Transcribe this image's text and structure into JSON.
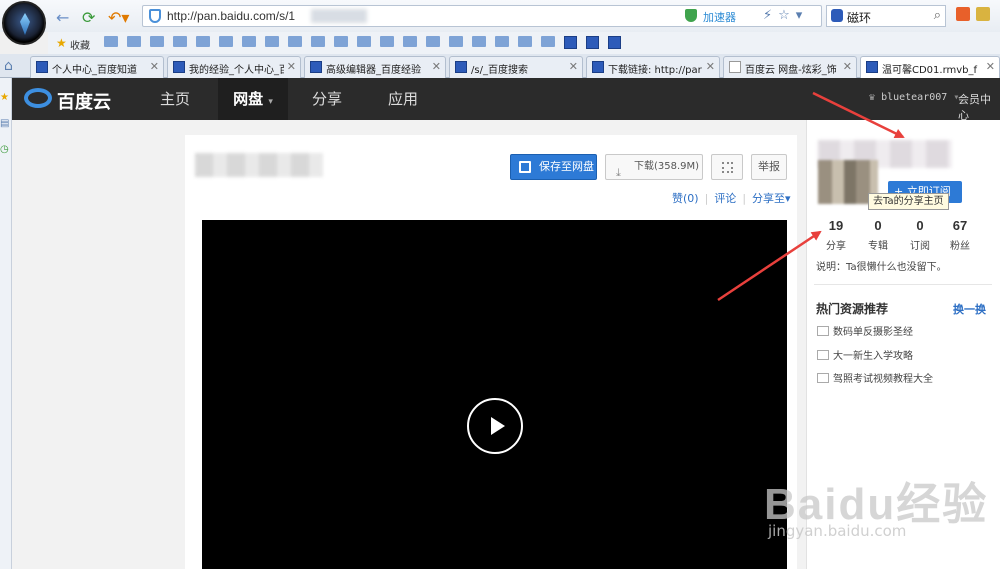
{
  "browser": {
    "url": "http://pan.baidu.com/s/1",
    "accelerator_label": "加速器",
    "search_value": "磁环",
    "bookmarks_label": "收藏"
  },
  "tabs": [
    {
      "label": "个人中心_百度知道"
    },
    {
      "label": "我的经验_个人中心_百"
    },
    {
      "label": "高级编辑器_百度经验"
    },
    {
      "label": "/s/_百度搜索"
    },
    {
      "label": "下载链接: http://par"
    },
    {
      "label": "百度云 网盘-炫彩_饰"
    },
    {
      "label": "温可馨CD01.rmvb_f"
    }
  ],
  "header": {
    "brand": "百度云",
    "nav": [
      "主页",
      "网盘",
      "分享",
      "应用"
    ],
    "active_nav": "网盘",
    "username": "bluetear007",
    "member_center": "会员中心"
  },
  "file": {
    "save_label": "保存至网盘",
    "download_label": "下载(358.9M)",
    "report_label": "举报",
    "like_label": "赞(0)",
    "comment_label": "评论",
    "share_to_label": "分享至"
  },
  "profile": {
    "subscribe_label": "+ 立即订阅",
    "tooltip": "去Ta的分享主页",
    "stats": [
      {
        "value": "19",
        "label": "分享"
      },
      {
        "value": "0",
        "label": "专辑"
      },
      {
        "value": "0",
        "label": "订阅"
      },
      {
        "value": "67",
        "label": "粉丝"
      }
    ],
    "description": "说明：Ta很懒什么也没留下。"
  },
  "hot": {
    "title": "热门资源推荐",
    "swap_label": "换一换",
    "items": [
      "数码单反摄影圣经",
      "大一新生入学攻略",
      "驾照考试视频教程大全"
    ]
  },
  "watermark": {
    "logo": "Baidu经验",
    "sub": "jingyan.baidu.com"
  },
  "colors": {
    "accent": "#2d7ad6",
    "header_bg": "#2b2b2b",
    "annotation_arrow": "#e8403c"
  }
}
